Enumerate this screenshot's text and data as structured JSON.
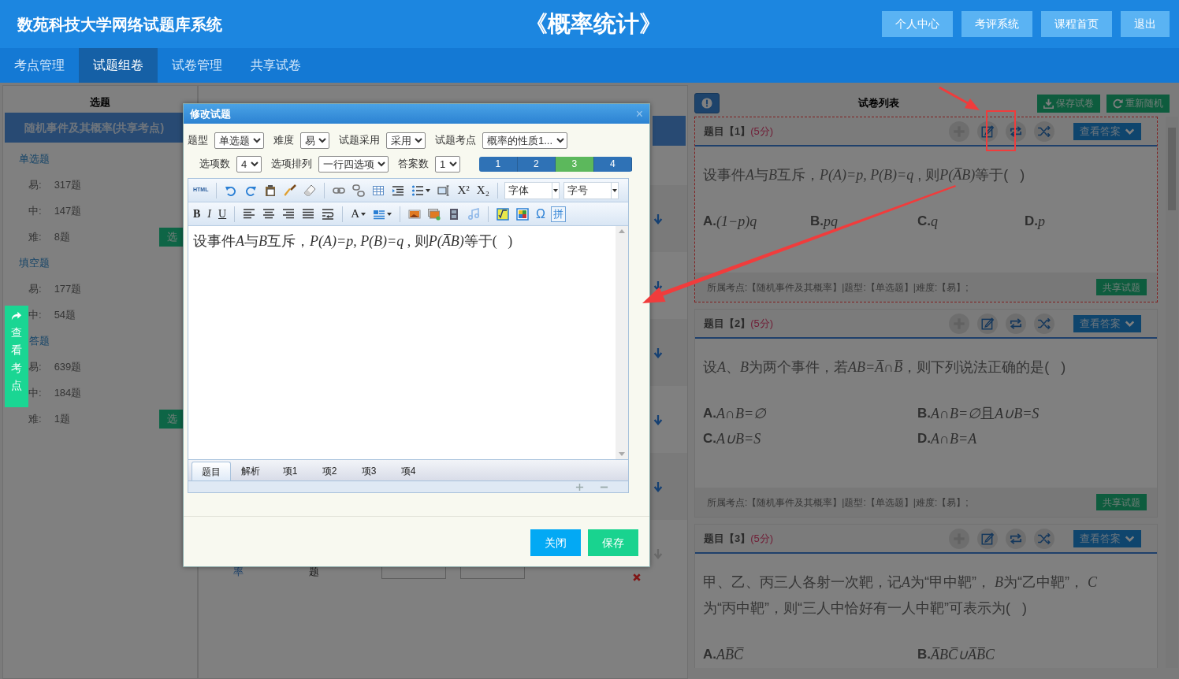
{
  "header": {
    "title": "数苑科技大学网络试题库系统",
    "course": "《概率统计》",
    "buttons": [
      "个人中心",
      "考评系统",
      "课程首页",
      "退出"
    ]
  },
  "nav": [
    {
      "label": "考点管理",
      "selected": false
    },
    {
      "label": "试题组卷",
      "selected": true
    },
    {
      "label": "试卷管理",
      "selected": false
    },
    {
      "label": "共享试卷",
      "selected": false
    }
  ],
  "select_panel": {
    "title": "选题",
    "topic": "随机事件及其概率(共享考点)",
    "groups": [
      {
        "name": "单选题",
        "button": "选",
        "rows": [
          {
            "difficulty": "易:",
            "count": "317题"
          },
          {
            "difficulty": "中:",
            "count": "147题"
          },
          {
            "difficulty": "难:",
            "count": "8题"
          }
        ]
      },
      {
        "name": "填空题",
        "rows": [
          {
            "difficulty": "易:",
            "count": "177题"
          },
          {
            "difficulty": "中:",
            "count": "54题"
          }
        ]
      },
      {
        "name": "答题",
        "button": "选",
        "rows": [
          {
            "difficulty": "易:",
            "count": "639题"
          },
          {
            "difficulty": "中:",
            "count": "184题"
          },
          {
            "difficulty": "难:",
            "count": "1题"
          }
        ]
      }
    ]
  },
  "side_tab": {
    "label": "查看考点"
  },
  "template_panel": {
    "rows": [
      {
        "disabled": false
      },
      {
        "disabled": false
      },
      {
        "disabled": false
      },
      {
        "disabled": false
      },
      {
        "disabled": false
      },
      {
        "disabled": true,
        "cells": [
          {
            "kind": "link",
            "text": "率"
          },
          {
            "kind": "plain",
            "text": "题"
          }
        ]
      }
    ]
  },
  "dialog": {
    "title": "修改试题",
    "close": "×",
    "fields_row_1": [
      {
        "label": "题型",
        "value": "单选题"
      },
      {
        "label": "难度",
        "value": "易"
      },
      {
        "label": "试题采用",
        "value": "采用"
      },
      {
        "label": "试题考点",
        "value": "概率的性质1..."
      }
    ],
    "fields_row_2": [
      {
        "label": "选项数",
        "value": "4"
      },
      {
        "label": "选项排列",
        "value": "一行四选项"
      },
      {
        "label": "答案数",
        "value": "1"
      }
    ],
    "answer_options": [
      {
        "label": "1",
        "selected": false
      },
      {
        "label": "2",
        "selected": false
      },
      {
        "label": "3",
        "selected": true
      },
      {
        "label": "4",
        "selected": false
      }
    ],
    "toolbar": {
      "html": "HTML",
      "superscript": "X²",
      "subscript": "X₂",
      "font": "字体",
      "size": "字号",
      "bold": "B",
      "italic": "I",
      "underline": "U",
      "text_color": "A",
      "special_char": "Ω",
      "pinyin": "拼"
    },
    "content": [
      {
        "kind": "text",
        "text": "设事件"
      },
      {
        "kind": "math",
        "text": "A"
      },
      {
        "kind": "text",
        "text": "与"
      },
      {
        "kind": "math",
        "text": "B"
      },
      {
        "kind": "text",
        "text": "互斥，"
      },
      {
        "kind": "math",
        "text": "P(A)=p, P(B)=q"
      },
      {
        "kind": "text",
        "text": " , 则"
      },
      {
        "kind": "math",
        "text": "P(A̅B)"
      },
      {
        "kind": "text",
        "text": "等于(   )"
      }
    ],
    "editor_tabs": [
      {
        "label": "题目",
        "selected": true
      },
      {
        "label": "解析",
        "selected": false
      },
      {
        "label": "项1",
        "selected": false
      },
      {
        "label": "项2",
        "selected": false
      },
      {
        "label": "项3",
        "selected": false
      },
      {
        "label": "项4",
        "selected": false
      }
    ],
    "buttons": [
      {
        "kind": "close",
        "label": "关闭"
      },
      {
        "kind": "save",
        "label": "保存"
      }
    ]
  },
  "paper": {
    "title": "试卷列表",
    "buttons": [
      {
        "kind": "save",
        "label": "保存试卷"
      },
      {
        "kind": "refresh",
        "label": "重新随机"
      }
    ],
    "questions": [
      {
        "title": "题目【1】",
        "score": "(5分)",
        "highlighted": true,
        "answer_button": "查看答案",
        "text": [
          {
            "kind": "text",
            "text": "设事件"
          },
          {
            "kind": "math",
            "text": "A"
          },
          {
            "kind": "text",
            "text": "与"
          },
          {
            "kind": "math",
            "text": "B"
          },
          {
            "kind": "text",
            "text": "互斥，"
          },
          {
            "kind": "math",
            "text": "P(A)=p, P(B)=q"
          },
          {
            "kind": "text",
            "text": " , 则"
          },
          {
            "kind": "math",
            "text": "P(A̅B)"
          },
          {
            "kind": "text",
            "text": "等于(   )"
          }
        ],
        "options": [
          {
            "label": "A.",
            "text": [
              {
                "kind": "math",
                "text": "(1−p)q"
              }
            ]
          },
          {
            "label": "B.",
            "text": [
              {
                "kind": "math",
                "text": "pq"
              }
            ]
          },
          {
            "label": "C.",
            "text": [
              {
                "kind": "math",
                "text": "q"
              }
            ]
          },
          {
            "label": "D.",
            "text": [
              {
                "kind": "math",
                "text": "p"
              }
            ]
          }
        ],
        "meta": "所属考点:【随机事件及其概率】|题型:【单选题】|难度:【易】;",
        "share_button": "共享试题"
      },
      {
        "title": "题目【2】",
        "score": "(5分)",
        "highlighted": false,
        "answer_button": "查看答案",
        "text": [
          {
            "kind": "text",
            "text": "设"
          },
          {
            "kind": "math",
            "text": "A"
          },
          {
            "kind": "text",
            "text": "、"
          },
          {
            "kind": "math",
            "text": "B"
          },
          {
            "kind": "text",
            "text": "为两个事件，若"
          },
          {
            "kind": "math",
            "text": "AB=A̅∩B̅"
          },
          {
            "kind": "text",
            "text": "，则下列说法正确的是(   )"
          }
        ],
        "options": [
          {
            "label": "A.",
            "text": [
              {
                "kind": "math",
                "text": "A∩B=∅"
              }
            ]
          },
          {
            "label": "B.",
            "text": [
              {
                "kind": "math",
                "text": "A∩B=∅"
              },
              {
                "kind": "text",
                "text": "且"
              },
              {
                "kind": "math",
                "text": "A∪B=S"
              }
            ]
          },
          {
            "label": "C.",
            "text": [
              {
                "kind": "math",
                "text": "A∪B=S"
              }
            ]
          },
          {
            "label": "D.",
            "text": [
              {
                "kind": "math",
                "text": "A∩B=A"
              }
            ]
          }
        ],
        "meta": "所属考点:【随机事件及其概率】|题型:【单选题】|难度:【易】;",
        "share_button": "共享试题"
      },
      {
        "title": "题目【3】",
        "score": "(5分)",
        "highlighted": false,
        "answer_button": "查看答案",
        "text": [
          {
            "kind": "text",
            "text": "甲、乙、丙三人各射一次靶，记"
          },
          {
            "kind": "math",
            "text": "A"
          },
          {
            "kind": "text",
            "text": "为“甲中靶”， "
          },
          {
            "kind": "math",
            "text": "B"
          },
          {
            "kind": "text",
            "text": "为“乙中靶”， "
          },
          {
            "kind": "math",
            "text": "C"
          },
          {
            "kind": "text",
            "text": "为“丙中靶”，则“三人中恰好有一人中靶”可表示为(   )"
          }
        ],
        "options": [
          {
            "label": "A.",
            "text": [
              {
                "kind": "math",
                "text": "AB̅C̅"
              }
            ]
          },
          {
            "label": "B.",
            "text": [
              {
                "kind": "math",
                "text": "A̅BC̅∪A̅B̅C"
              }
            ]
          }
        ]
      }
    ]
  }
}
